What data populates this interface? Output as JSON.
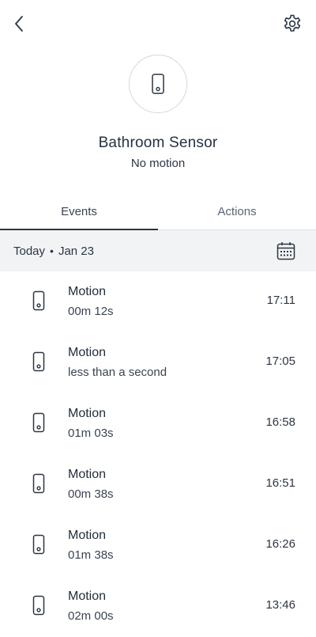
{
  "header": {
    "back_icon": "chevron-left-icon",
    "settings_icon": "gear-icon"
  },
  "device": {
    "icon": "sensor-device-icon",
    "name": "Bathroom Sensor",
    "status": "No motion"
  },
  "tabs": [
    {
      "label": "Events",
      "active": true
    },
    {
      "label": "Actions",
      "active": false
    }
  ],
  "date_bar": {
    "day": "Today",
    "separator": "•",
    "date": "Jan 23",
    "calendar_icon": "calendar-icon"
  },
  "events": [
    {
      "title": "Motion",
      "duration": "00m 12s",
      "time": "17:11"
    },
    {
      "title": "Motion",
      "duration": "less than a second",
      "time": "17:05"
    },
    {
      "title": "Motion",
      "duration": "01m 03s",
      "time": "16:58"
    },
    {
      "title": "Motion",
      "duration": "00m 38s",
      "time": "16:51"
    },
    {
      "title": "Motion",
      "duration": "01m 38s",
      "time": "16:26"
    },
    {
      "title": "Motion",
      "duration": "02m 00s",
      "time": "13:46"
    }
  ],
  "colors": {
    "text": "#1f2b3a",
    "date_bar_bg": "#f2f3f5",
    "divider": "#dfe3e8",
    "tab_indicator": "#2b3542"
  }
}
